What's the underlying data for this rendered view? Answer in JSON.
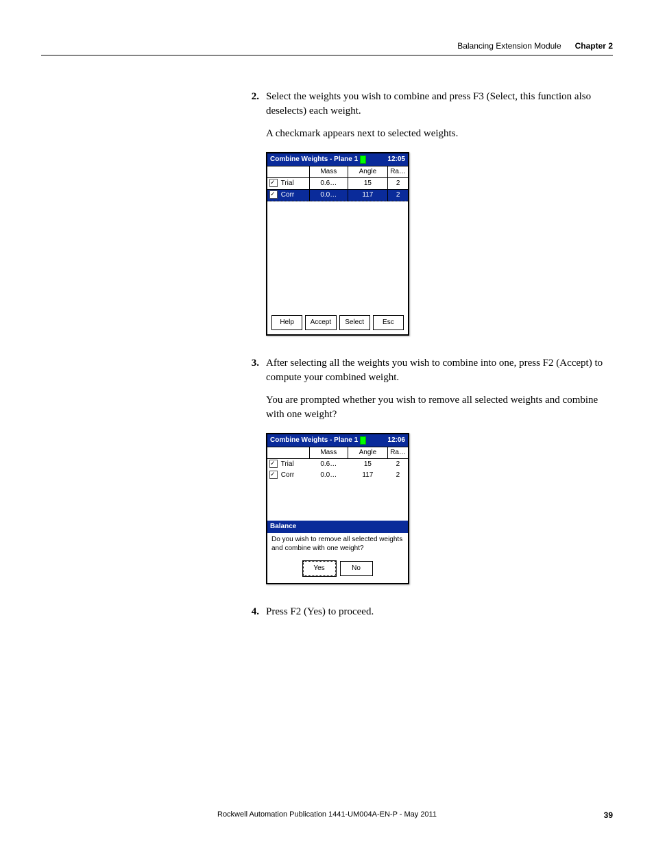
{
  "header": {
    "section": "Balancing Extension Module",
    "chapter": "Chapter 2"
  },
  "steps": {
    "s2": {
      "num": "2.",
      "text": "Select the weights you wish to combine and press F3 (Select, this function also deselects) each weight."
    },
    "s2_note": "A checkmark appears next to selected weights.",
    "s3": {
      "num": "3.",
      "text": "After selecting all the weights you wish to combine into one, press F2 (Accept) to compute your combined weight."
    },
    "s3_note": "You are prompted whether you wish to remove all selected weights and combine with one weight?",
    "s4": {
      "num": "4.",
      "text": "Press F2 (Yes) to proceed."
    }
  },
  "device1": {
    "title": "Combine Weights - Plane 1",
    "time": "12:05",
    "cols": {
      "c1": "",
      "c2": "Mass",
      "c3": "Angle",
      "c4": "Ra…"
    },
    "rows": [
      {
        "name": "Trial",
        "mass": "0.6…",
        "angle": "15",
        "ra": "2",
        "checked": true,
        "selected": false
      },
      {
        "name": "Corr",
        "mass": "0.0…",
        "angle": "117",
        "ra": "2",
        "checked": true,
        "selected": true
      }
    ],
    "buttons": {
      "b1": "Help",
      "b2": "Accept",
      "b3": "Select",
      "b4": "Esc"
    }
  },
  "device2": {
    "title": "Combine Weights - Plane 1",
    "time": "12:06",
    "cols": {
      "c1": "",
      "c2": "Mass",
      "c3": "Angle",
      "c4": "Ra…"
    },
    "rows": [
      {
        "name": "Trial",
        "mass": "0.6…",
        "angle": "15",
        "ra": "2",
        "checked": true
      },
      {
        "name": "Corr",
        "mass": "0.0…",
        "angle": "117",
        "ra": "2",
        "checked": true
      }
    ],
    "dialog": {
      "title": "Balance",
      "line1": "Do you wish to remove all selected weights",
      "line2": "and combine with one weight?",
      "yes": "Yes",
      "no": "No"
    }
  },
  "footer": {
    "pub": "Rockwell Automation Publication 1441-UM004A-EN-P - May 2011",
    "page": "39"
  }
}
